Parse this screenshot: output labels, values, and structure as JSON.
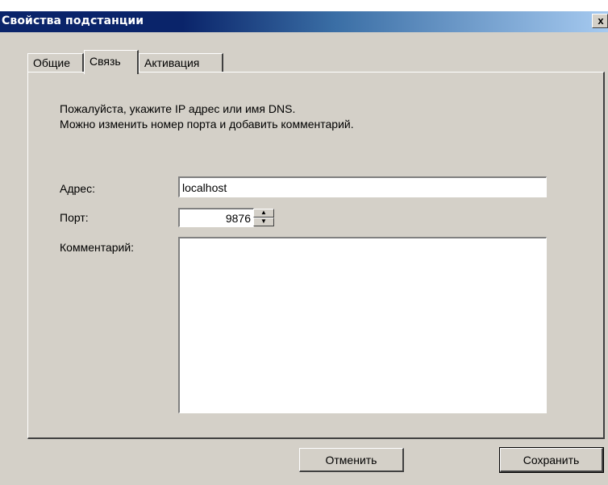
{
  "window": {
    "title": "Свойства подстанции",
    "close_glyph": "x"
  },
  "tabs": [
    {
      "label": "Общие",
      "active": false
    },
    {
      "label": "Связь",
      "active": true
    },
    {
      "label": "Активация",
      "active": false
    }
  ],
  "info": {
    "line1": "Пожалуйста, укажите IP адрес или имя DNS.",
    "line2": "Можно изменить номер порта и добавить комментарий."
  },
  "form": {
    "address_label": "Адрес:",
    "address_value": "localhost",
    "port_label": "Порт:",
    "port_value": "9876",
    "comment_label": "Комментарий:",
    "comment_value": ""
  },
  "spinner": {
    "up_glyph": "▲",
    "down_glyph": "▼"
  },
  "buttons": {
    "cancel": "Отменить",
    "save": "Сохранить"
  },
  "colors": {
    "title_gradient_start": "#0a246a",
    "title_gradient_end": "#a6caf0",
    "face": "#d4d0c8"
  }
}
